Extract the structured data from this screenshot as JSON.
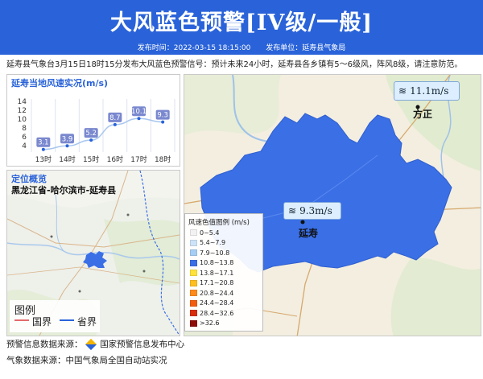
{
  "header": {
    "title": "大风蓝色预警[IV级/一般]",
    "publish_time": "发布时间：2022-03-15 18:15:00",
    "publisher": "发布单位：延寿县气象局"
  },
  "summary": "延寿县气象台3月15日18时15分发布大风蓝色预警信号：预计未来24小时，延寿县各乡镇有5～6级风，阵风8级，请注意防范。",
  "wind_panel": {
    "title": "延寿当地风速实况(m/s)"
  },
  "chart_data": {
    "type": "line",
    "title": "延寿当地风速实况(m/s)",
    "categories": [
      "13时",
      "14时",
      "15时",
      "16时",
      "17时",
      "18时"
    ],
    "values": [
      3.1,
      3.9,
      5.2,
      8.7,
      10.1,
      9.3
    ],
    "yticks": [
      4,
      6,
      8,
      10,
      12,
      14
    ],
    "ylim": [
      2.5,
      14.5
    ],
    "colors": {
      "line": "#a8c6ee",
      "label_bg": "#7a88cf",
      "point": "#2a63d9"
    }
  },
  "location_panel": {
    "title": "定位概览",
    "path": "黑龙江省-哈尔滨市-延寿县",
    "legend_title": "图例",
    "legend_national": "国界",
    "legend_province": "省界"
  },
  "map": {
    "legend_title": "风速色值图例 (m/s)",
    "legend": [
      {
        "label": "0~5.4",
        "color": "#f2f2f2"
      },
      {
        "label": "5.4~7.9",
        "color": "#cde3f7"
      },
      {
        "label": "7.9~10.8",
        "color": "#a6cdf3"
      },
      {
        "label": "10.8~13.8",
        "color": "#3a6fe6"
      },
      {
        "label": "13.8~17.1",
        "color": "#ffe33a"
      },
      {
        "label": "17.1~20.8",
        "color": "#ffbf1f"
      },
      {
        "label": "20.8~24.4",
        "color": "#ff8b1a"
      },
      {
        "label": "24.4~28.4",
        "color": "#f25c0f"
      },
      {
        "label": "28.4~32.6",
        "color": "#d92d0a"
      },
      {
        "label": ">32.6",
        "color": "#8c0c06"
      }
    ],
    "region_color": "#3a6fe6",
    "stations": [
      {
        "name": "方正",
        "wind": "11.1m/s"
      },
      {
        "name": "延寿",
        "wind": "9.3m/s"
      }
    ]
  },
  "footer": {
    "warning_source_label": "预警信息数据来源：",
    "warning_source": "国家预警信息发布中心",
    "weather_source": "气象数据来源：中国气象局全国自动站实况"
  }
}
